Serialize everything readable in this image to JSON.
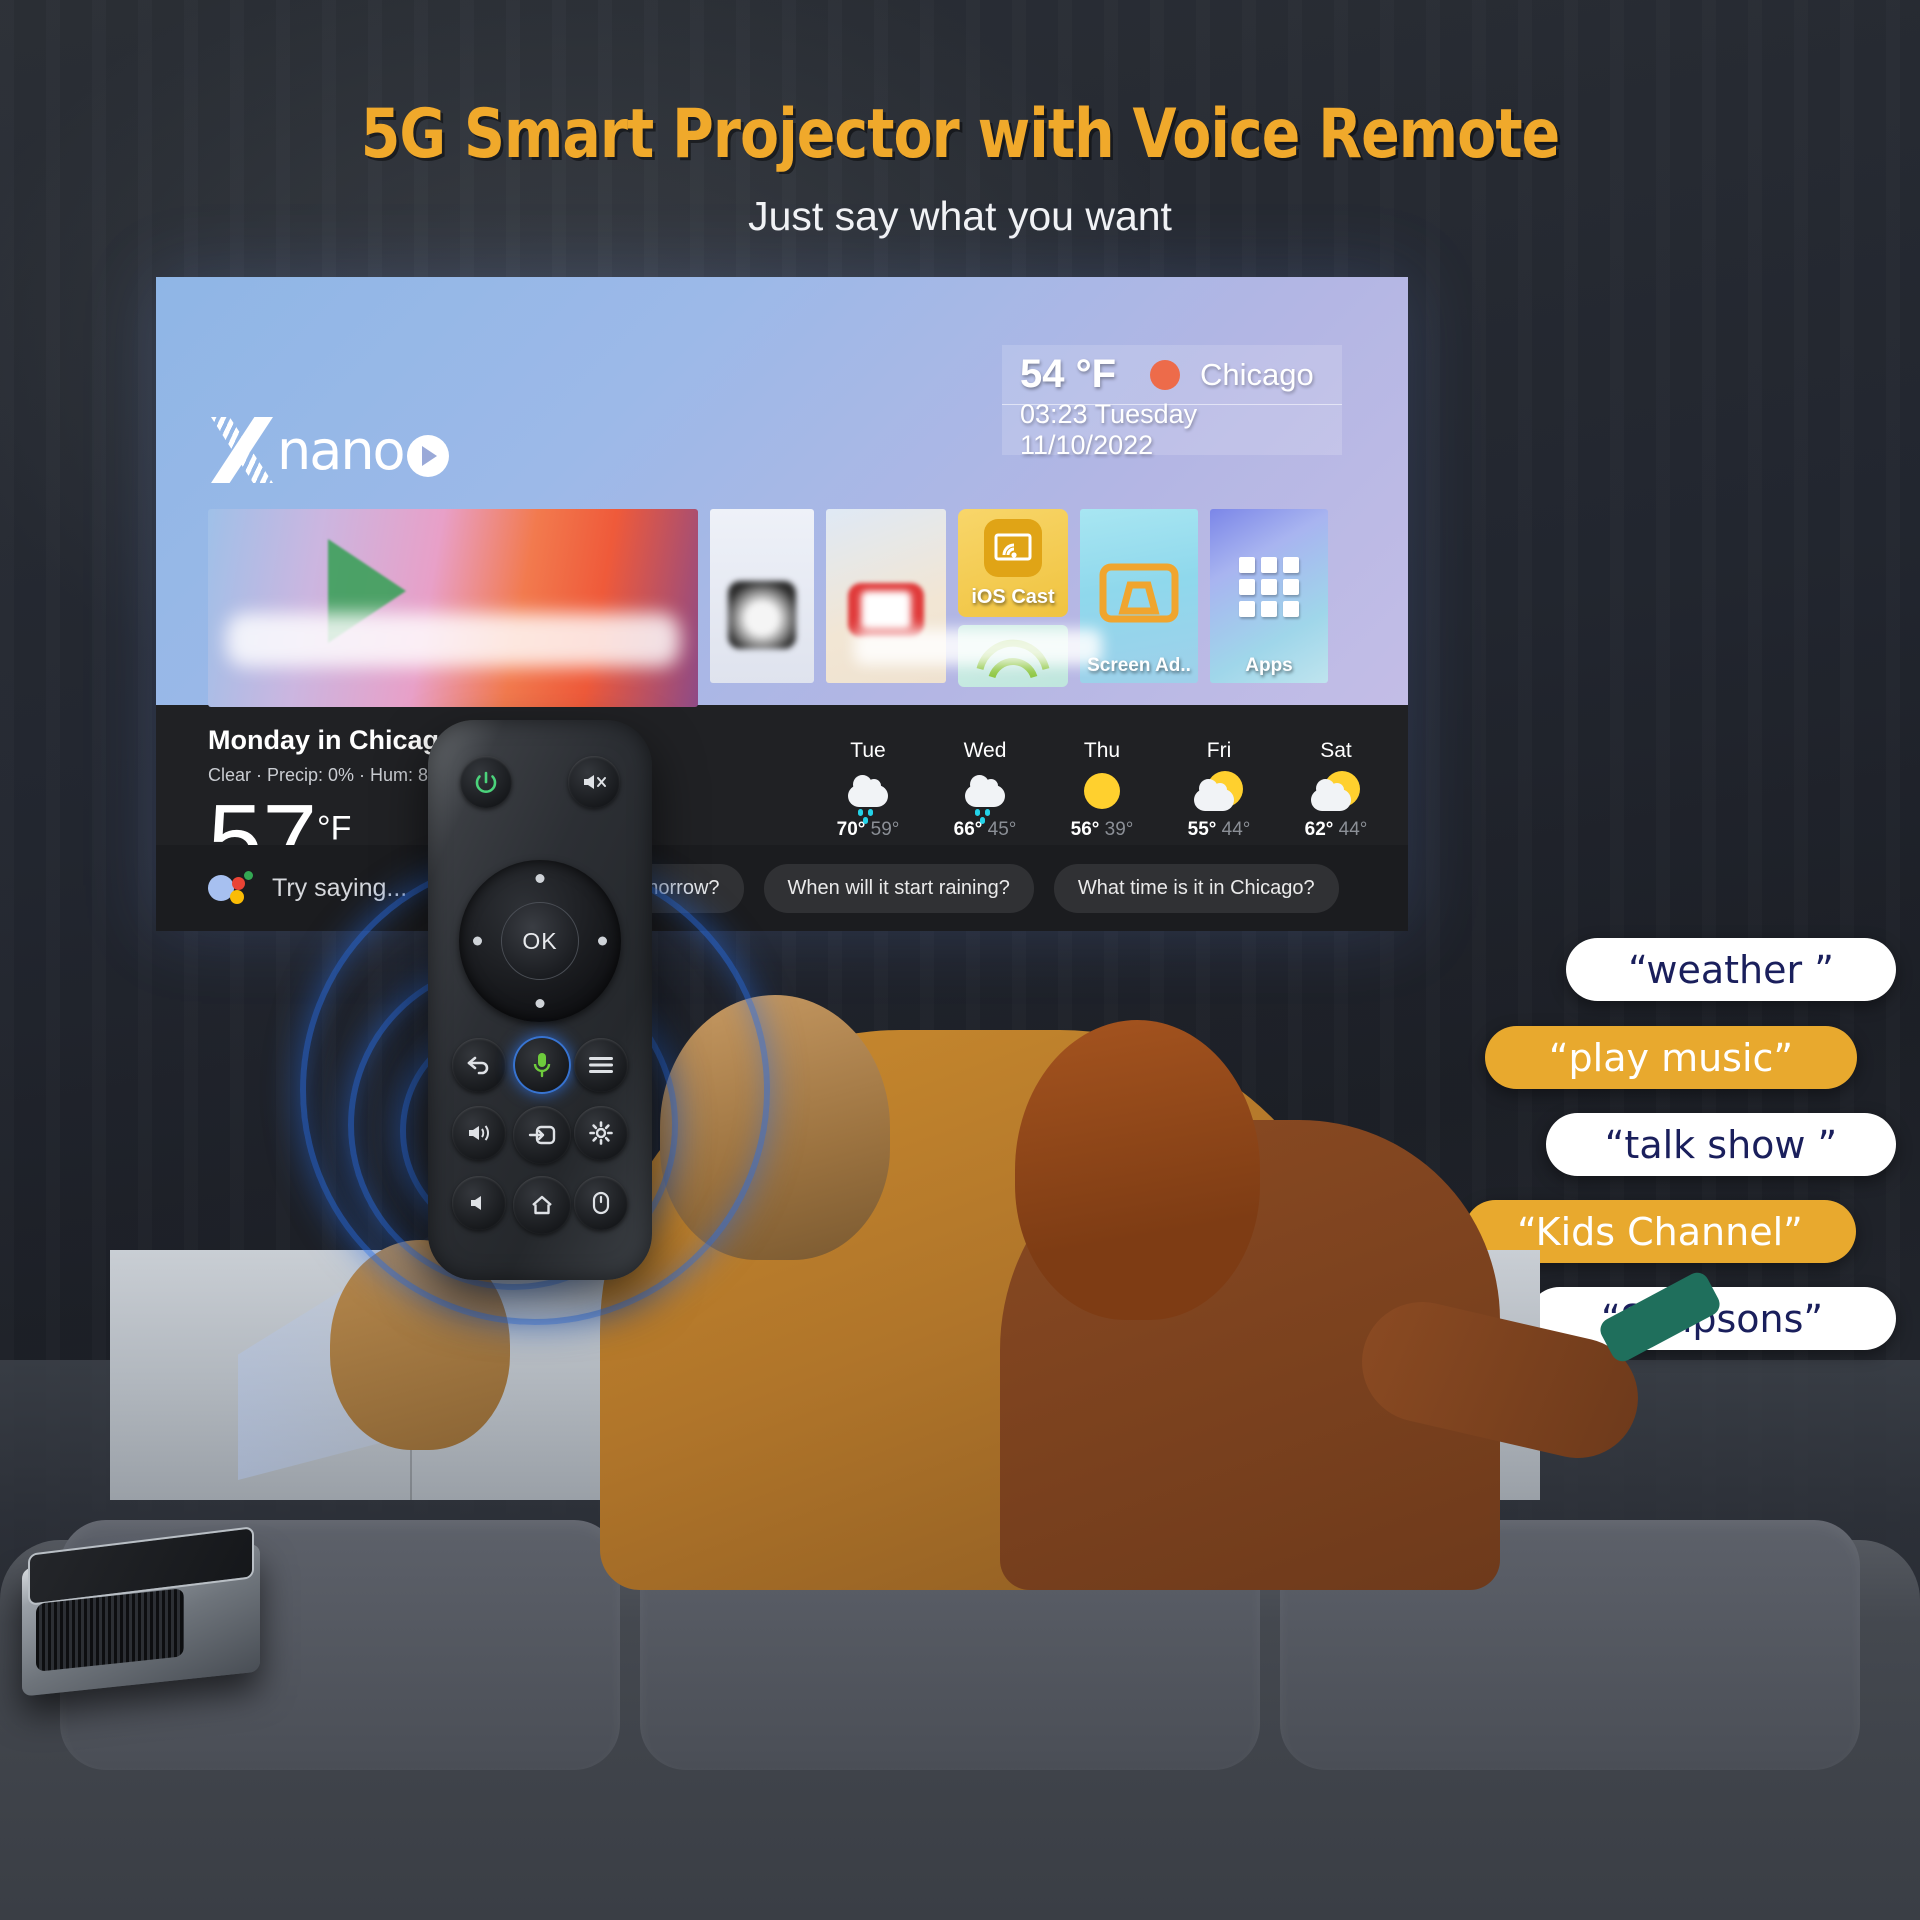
{
  "header": {
    "headline": "5G Smart Projector with  Voice Remote",
    "subhead": "Just say what you want"
  },
  "tv": {
    "brand_logo": "Xnano",
    "brand_logo_text": "nano",
    "weather_widget": {
      "temperature": "54 °F",
      "condition_icon": "orange-dot-icon",
      "city": "Chicago",
      "datetime": "03:23 Tuesday 11/10/2022"
    },
    "tiles": [
      {
        "label": "",
        "icon": "play-store-hero"
      },
      {
        "label": "",
        "icon": "app-thumb"
      },
      {
        "label": "",
        "icon": "youtube-icon"
      },
      {
        "label": "iOS Cast",
        "icon": "cast-icon"
      },
      {
        "label": "",
        "icon": "wifi-icon"
      },
      {
        "label": "Screen Ad..",
        "icon": "keystone-icon"
      },
      {
        "label": "Apps",
        "icon": "grid-icon"
      }
    ],
    "weather_detail": {
      "title": "Monday in Chicago",
      "subtitle": "Clear · Precip: 0% · Hum: 86% · More on ",
      "current_temp": "57",
      "unit": "°F"
    },
    "forecast": [
      {
        "day": "Tue",
        "icon": "rain",
        "high": "70°",
        "low": "59°"
      },
      {
        "day": "Wed",
        "icon": "rain",
        "high": "66°",
        "low": "45°"
      },
      {
        "day": "Thu",
        "icon": "sun",
        "high": "56°",
        "low": "39°"
      },
      {
        "day": "Fri",
        "icon": "partly",
        "high": "55°",
        "low": "44°"
      },
      {
        "day": "Sat",
        "icon": "partly",
        "high": "62°",
        "low": "44°"
      }
    ],
    "assistant": {
      "icon": "google-assistant-icon",
      "prompt": "Try saying...",
      "chips": [
        "What about tomorrow?",
        "When will it start raining?",
        "What time is it in Chicago?"
      ]
    }
  },
  "callouts": [
    {
      "text": "“weather ”",
      "style": "white"
    },
    {
      "text": "“play music”",
      "style": "amber"
    },
    {
      "text": "“talk show ”",
      "style": "white"
    },
    {
      "text": "“Kids Channel”",
      "style": "amber"
    },
    {
      "text": "“Simpsons”",
      "style": "white"
    }
  ],
  "remote": {
    "buttons": [
      {
        "name": "power-button",
        "glyph": "⏻"
      },
      {
        "name": "mute-button",
        "glyph": "🔇"
      },
      {
        "name": "ok-button",
        "glyph": "OK"
      },
      {
        "name": "back-button",
        "glyph": "↩"
      },
      {
        "name": "mic-button",
        "glyph": "🎤"
      },
      {
        "name": "menu-button",
        "glyph": "☰"
      },
      {
        "name": "volume-up-button",
        "glyph": "🔊"
      },
      {
        "name": "input-source-button",
        "glyph": "⏺"
      },
      {
        "name": "settings-button",
        "glyph": "⚙"
      },
      {
        "name": "volume-down-button",
        "glyph": "🔈"
      },
      {
        "name": "home-button",
        "glyph": "⌂"
      },
      {
        "name": "mouse-button",
        "glyph": "🖱"
      }
    ]
  },
  "colors": {
    "headline": "#F0A92B",
    "callout_amber": "#E8A92E",
    "callout_navy": "#1A1F5C",
    "weather_dot": "#ED6B4A",
    "mic_green": "#6ECB3C",
    "glow_blue": "#286EE6"
  }
}
